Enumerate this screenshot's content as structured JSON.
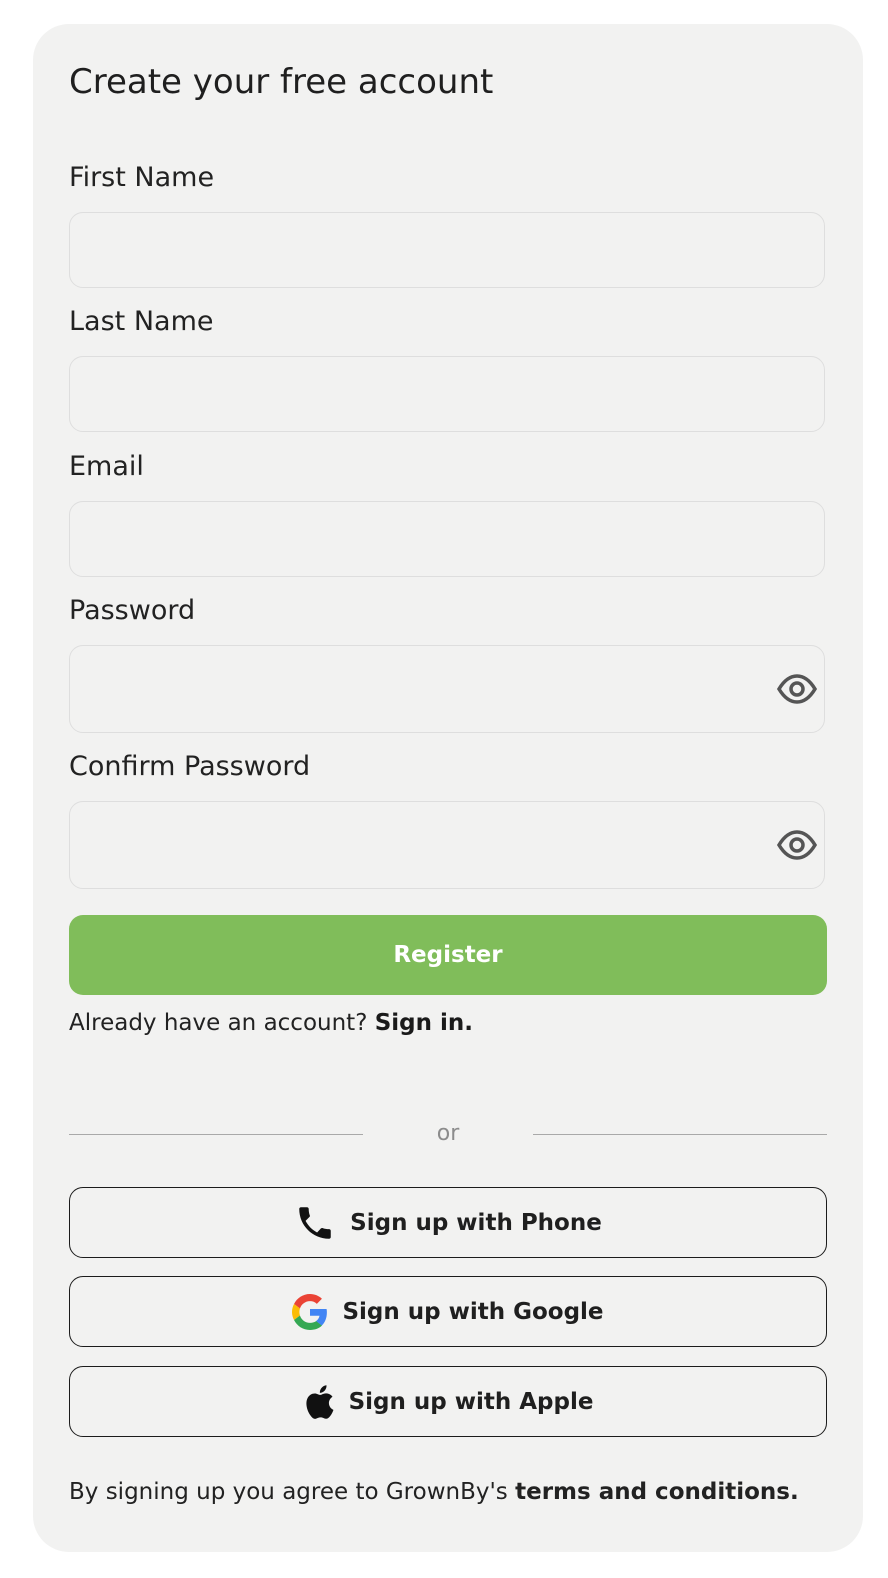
{
  "form": {
    "title": "Create your free account",
    "fields": [
      {
        "label": "First Name",
        "value": "",
        "placeholder": ""
      },
      {
        "label": "Last Name",
        "value": "",
        "placeholder": ""
      },
      {
        "label": "Email",
        "value": "",
        "placeholder": ""
      },
      {
        "label": "Password",
        "value": "",
        "placeholder": ""
      },
      {
        "label": "Confirm Password",
        "value": "",
        "placeholder": ""
      }
    ],
    "register_label": "Register",
    "have_account_text": "Already have an account?",
    "sign_in_link": "Sign in.",
    "or_text": "or"
  },
  "social": {
    "phone_label": "Sign up with Phone",
    "google_label": "Sign up with Google",
    "apple_label": "Sign up with Apple",
    "phone_icon": "phone-icon",
    "google_icon": "google-icon",
    "apple_icon": "apple-icon"
  },
  "footer": {
    "terms_prefix": "By signing up you agree to GrownBy's",
    "terms_link": "terms and conditions."
  },
  "colors": {
    "accent": "#80bd5a",
    "card_background": "#f2f2f1",
    "text": "#222222"
  }
}
